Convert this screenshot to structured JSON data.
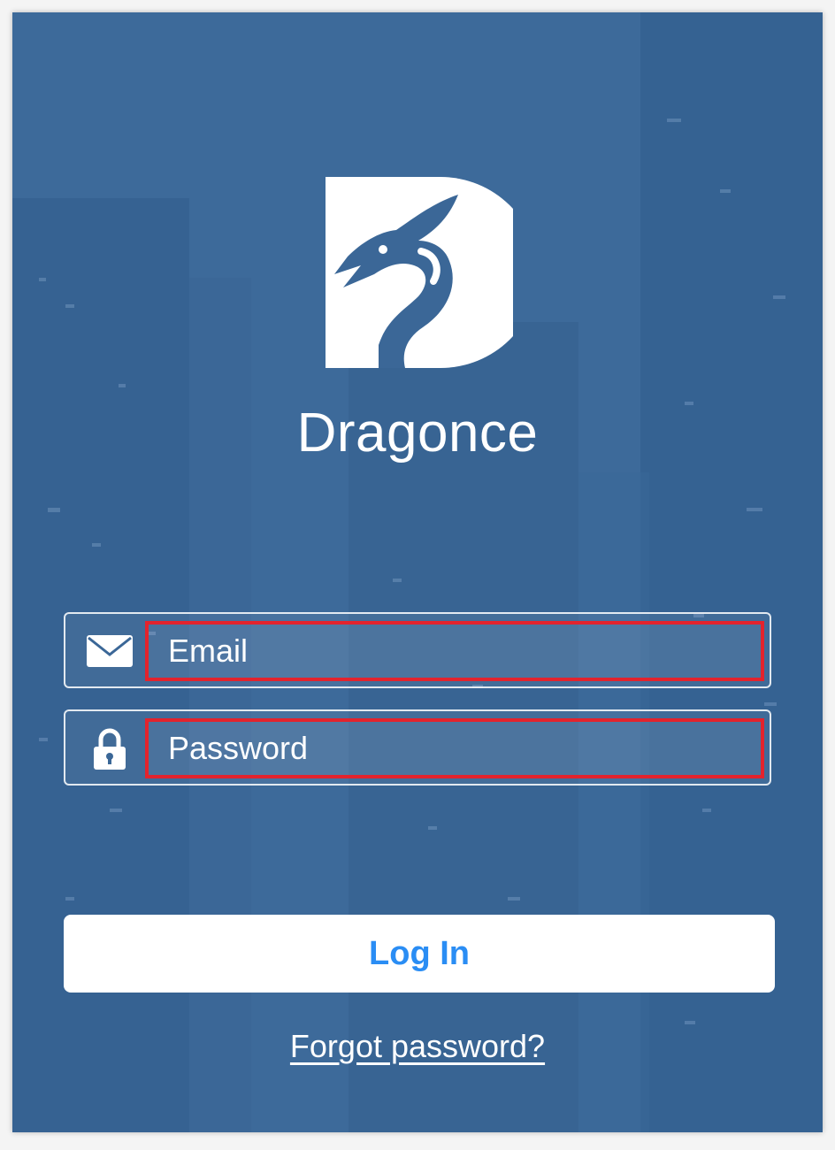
{
  "app": {
    "name": "Dragonce"
  },
  "login_form": {
    "email_placeholder": "Email",
    "password_placeholder": "Password",
    "login_label": "Log In",
    "forgot_label": "Forgot password?"
  },
  "icons": {
    "logo": "dragon-logo",
    "email": "envelope-icon",
    "password": "lock-icon"
  },
  "colors": {
    "background": "#3b6797",
    "highlight_border": "#e3232d",
    "button_text": "#2a8df4",
    "button_bg": "#ffffff"
  }
}
